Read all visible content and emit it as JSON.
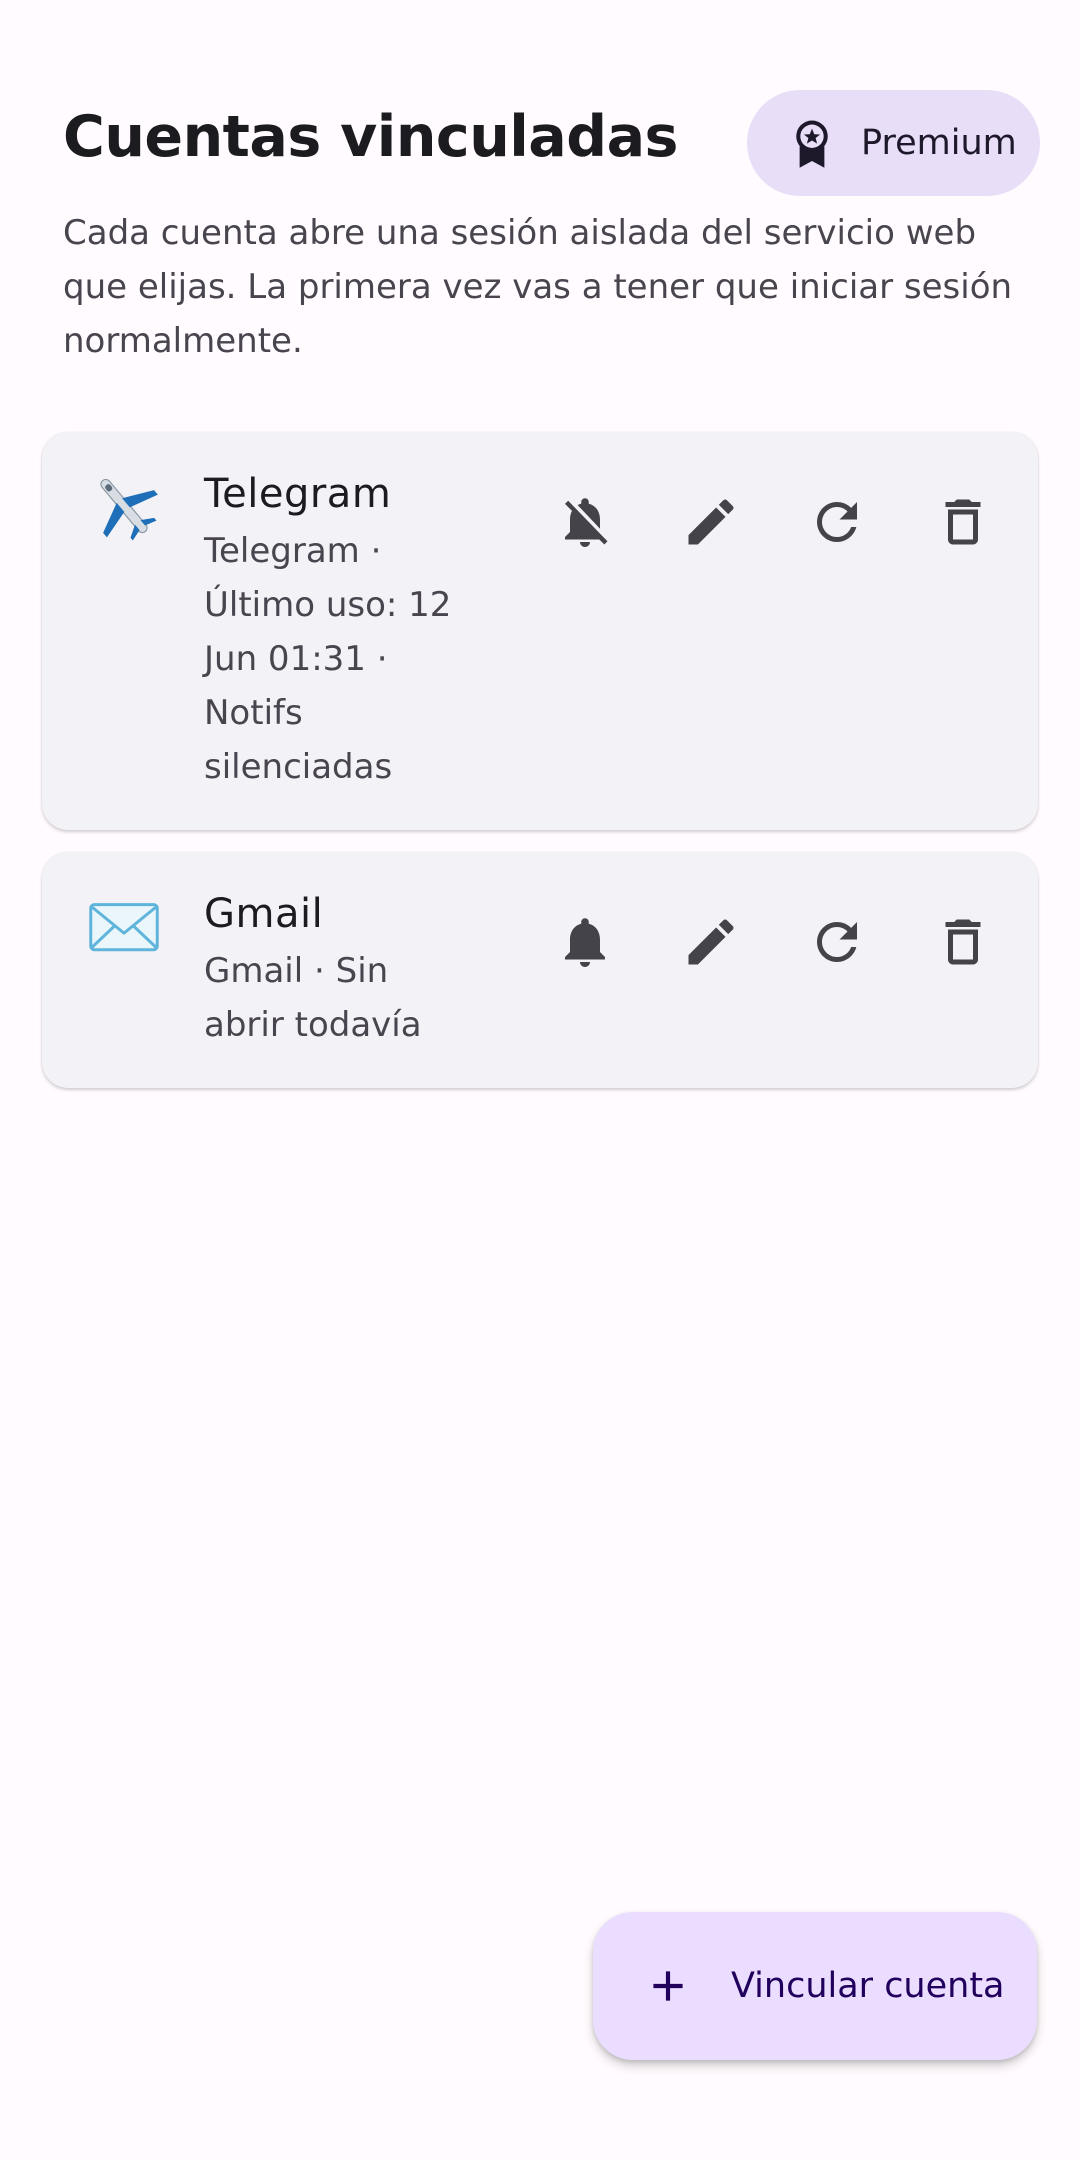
{
  "header": {
    "title": "Cuentas vinculadas",
    "premium_label": "Premium",
    "premium_icon": "premium-badge-icon"
  },
  "subtitle": "Cada cuenta abre una sesión aislada del servicio web que elijas. La primera vez vas a tener que iniciar sesión normalmente.",
  "accounts": [
    {
      "name": "Telegram",
      "emoji": "✈️",
      "detail": "Telegram · Último uso: 12 Jun 01:31 · Notifs silenciadas",
      "notifications": "muted",
      "actions": [
        "bell-off-icon",
        "pencil-icon",
        "refresh-icon",
        "trash-icon"
      ]
    },
    {
      "name": "Gmail",
      "emoji": "✉️",
      "detail": "Gmail · Sin abrir todavía",
      "notifications": "on",
      "actions": [
        "bell-icon",
        "pencil-icon",
        "refresh-icon",
        "trash-icon"
      ]
    }
  ],
  "fab": {
    "label": "Vincular cuenta",
    "icon": "plus-icon"
  },
  "colors": {
    "background": "#fffbfe",
    "card": "#f3f2f7",
    "premium_button": "#e8def8",
    "fab": "#eaddff",
    "icon": "#45434a"
  }
}
